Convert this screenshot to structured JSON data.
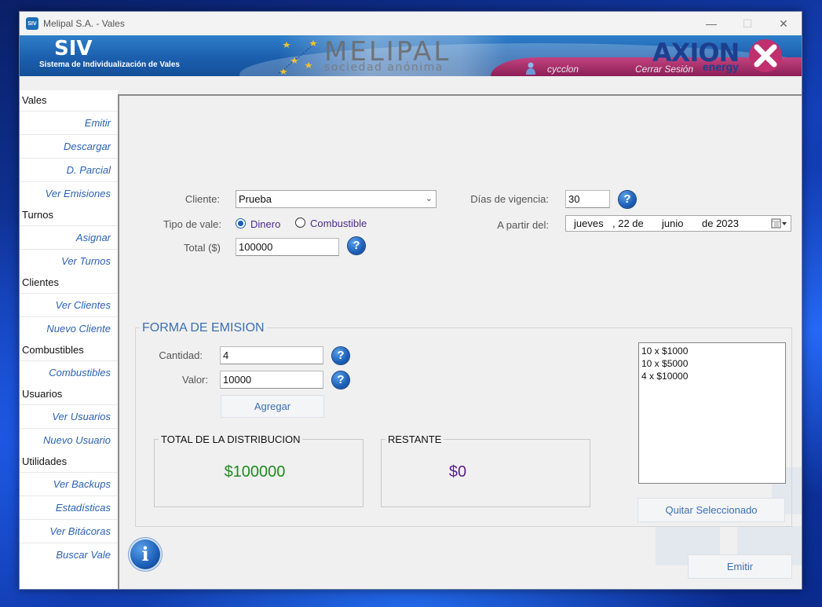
{
  "window": {
    "title": "Melipal S.A. - Vales",
    "app_icon_text": "SIV",
    "controls": {
      "minimize": "—",
      "maximize": "☐",
      "close": "✕"
    }
  },
  "banner": {
    "app_name": "SIV",
    "app_subtitle": "Sistema de Individualización de Vales",
    "company_name": "MELIPAL",
    "company_subtitle": "sociedad anónima",
    "user_name": "cycclon",
    "logout_label": "Cerrar Sesión",
    "partner_name": "AXION",
    "partner_sub": "energy",
    "accent_blue": "#1b5fae",
    "accent_magenta": "#a82d6a"
  },
  "sidebar": {
    "sections": [
      {
        "title": "Vales",
        "items": [
          "Emitir",
          "Descargar",
          "D. Parcial",
          "Ver Emisiones"
        ]
      },
      {
        "title": "Turnos",
        "items": [
          "Asignar",
          "Ver Turnos"
        ]
      },
      {
        "title": "Clientes",
        "items": [
          "Ver Clientes",
          "Nuevo Cliente"
        ]
      },
      {
        "title": "Combustibles",
        "items": [
          "Combustibles"
        ]
      },
      {
        "title": "Usuarios",
        "items": [
          "Ver Usuarios",
          "Nuevo Usuario"
        ]
      },
      {
        "title": "Utilidades",
        "items": [
          "Ver Backups",
          "Estadísticas",
          "Ver Bitácoras",
          "Buscar Vale"
        ]
      }
    ]
  },
  "form": {
    "cliente_label": "Cliente:",
    "cliente_value": "Prueba",
    "tipo_label": "Tipo de vale:",
    "tipo_options": [
      "Dinero",
      "Combustible"
    ],
    "tipo_selected": "Dinero",
    "total_label": "Total ($)",
    "total_value": "100000",
    "dias_label": "Días de vigencia:",
    "dias_value": "30",
    "apartir_label": "A partir del:",
    "date": {
      "weekday": "jueves",
      "day": ", 22 de",
      "month": "junio",
      "year": "de 2023"
    },
    "help_glyph": "?"
  },
  "emision": {
    "title": "FORMA DE EMISION",
    "cantidad_label": "Cantidad:",
    "cantidad_value": "4",
    "valor_label": "Valor:",
    "valor_value": "10000",
    "agregar_label": "Agregar",
    "total_title": "TOTAL DE LA DISTRIBUCION",
    "total_value": "$100000",
    "total_color": "#1f8a1f",
    "restante_title": "RESTANTE",
    "restante_value": "$0",
    "restante_color": "#5a1f8a",
    "list_items": [
      "10 x $1000",
      "10 x $5000",
      "4 x $10000"
    ],
    "quitar_label": "Quitar Seleccionado"
  },
  "footer": {
    "info_glyph": "i",
    "emitir_label": "Emitir"
  }
}
